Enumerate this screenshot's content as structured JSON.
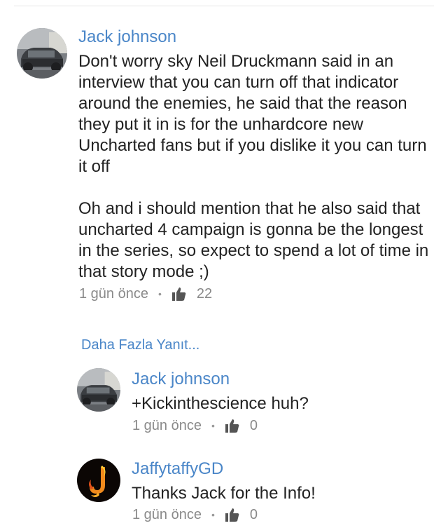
{
  "comment": {
    "author": "Jack johnson",
    "paragraphs": [
      "Don't worry sky Neil Druckmann said in an interview that you can turn off that indicator around the enemies, he said that the reason they put it in is for the unhardcore new Uncharted fans but if you dislike it you can turn it off",
      "Oh and i should mention that he also said that uncharted 4 campaign is gonna be the longest in the series, so expect to spend a lot of time in that story mode ;)"
    ],
    "time": "1 gün önce",
    "likes": "22"
  },
  "more_replies": "Daha Fazla Yanıt...",
  "replies": [
    {
      "author": "Jack johnson",
      "text": "+Kickinthescience huh?",
      "time": "1 gün önce",
      "likes": "0",
      "avatar_icon": "car-avatar"
    },
    {
      "author": "JaffytaffyGD",
      "text": "Thanks Jack for the Info!",
      "time": "1 gün önce",
      "likes": "0",
      "avatar_icon": "flaming-j-avatar"
    }
  ],
  "colors": {
    "link": "#4a86c8",
    "text": "#222222",
    "meta": "#8a8a8a"
  }
}
